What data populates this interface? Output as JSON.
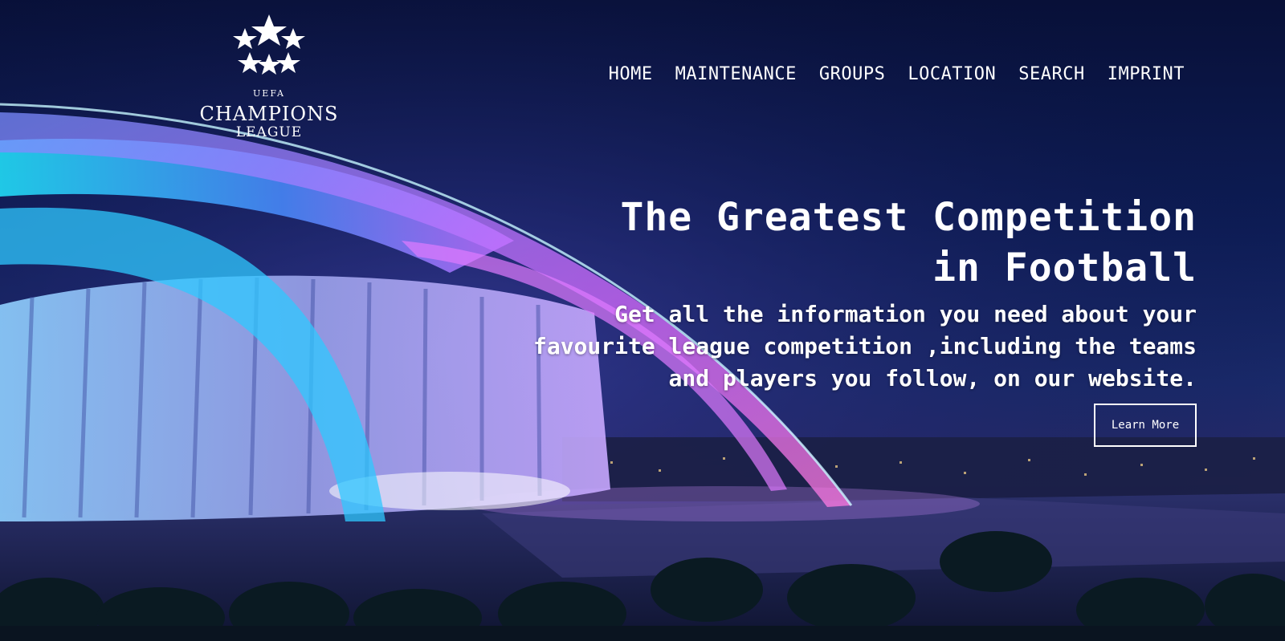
{
  "logo": {
    "uefa": "UEFA",
    "champions": "CHAMPIONS",
    "league": "LEAGUE"
  },
  "nav": {
    "items": [
      "HOME",
      "MAINTENANCE",
      "GROUPS",
      "LOCATION",
      "SEARCH",
      "IMPRINT"
    ]
  },
  "hero": {
    "title_line1": "The Greatest Competition",
    "title_line2": "in Football",
    "sub_line1": "Get all the information you need about your",
    "sub_line2": "favourite league competition ,including the teams",
    "sub_line3": "and players you follow, on our website.",
    "button_label": "Learn More"
  },
  "colors": {
    "sky": "#0d1c55",
    "cyan_glow": "#3fd8ff",
    "magenta_glow": "#d86bff",
    "text": "#ffffff"
  }
}
